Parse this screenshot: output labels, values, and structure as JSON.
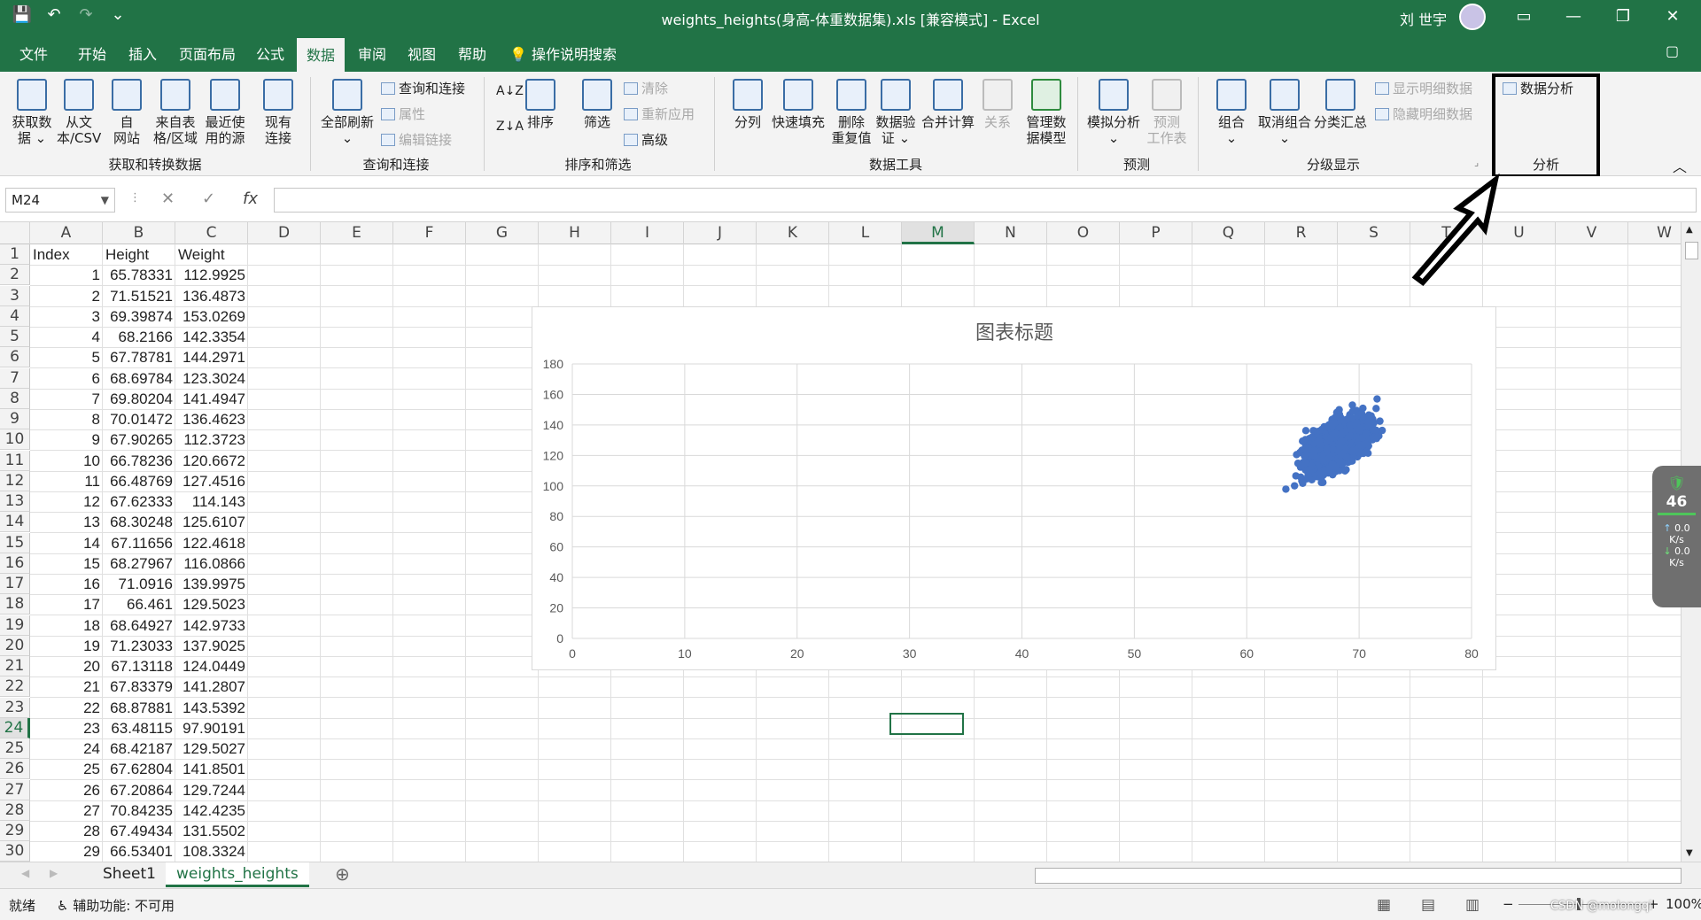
{
  "window": {
    "title": "weights_heights(身高-体重数据集).xls  [兼容模式]  -  Excel",
    "user": "刘 世宇",
    "minimize": "—",
    "maximize": "❐",
    "close": "✕"
  },
  "qat": {
    "save": "💾",
    "undo": "↶",
    "redo": "↷",
    "customize": "⌄"
  },
  "tabs": [
    "文件",
    "开始",
    "插入",
    "页面布局",
    "公式",
    "数据",
    "审阅",
    "视图",
    "帮助"
  ],
  "active_tab": "数据",
  "search_label": "操作说明搜索",
  "ribbon": {
    "get_data": "获取数\n据 ⌄",
    "from_csv": "从文\n本/CSV",
    "from_web": "自\n网站",
    "from_table": "来自表\n格/区域",
    "recent_sources": "最近使\n用的源",
    "existing_conn": "现有\n连接",
    "group1": "获取和转换数据",
    "refresh_all": "全部刷新\n⌄",
    "queries_conn": "查询和连接",
    "properties": "属性",
    "edit_links": "编辑链接",
    "group2": "查询和连接",
    "sort": "排序",
    "filter": "筛选",
    "clear": "清除",
    "reapply": "重新应用",
    "advanced": "高级",
    "group3": "排序和筛选",
    "text_to_col": "分列",
    "flash_fill": "快速填充",
    "remove_dup": "删除\n重复值",
    "data_val": "数据验\n证 ⌄",
    "consolidate": "合并计算",
    "relationships": "关系",
    "data_model": "管理数\n据模型",
    "group4": "数据工具",
    "what_if": "模拟分析\n⌄",
    "forecast_sheet": "预测\n工作表",
    "group5": "预测",
    "group_btn": "组合\n⌄",
    "ungroup": "取消组合\n⌄",
    "subtotal": "分类汇总",
    "show_detail": "显示明细数据",
    "hide_detail": "隐藏明细数据",
    "group6": "分级显示",
    "data_analysis": "数据分析",
    "group7": "分析"
  },
  "name_box": "M24",
  "columns": [
    "A",
    "B",
    "C",
    "D",
    "E",
    "F",
    "G",
    "H",
    "I",
    "J",
    "K",
    "L",
    "M",
    "N",
    "O",
    "P",
    "Q",
    "R",
    "S",
    "T",
    "U",
    "V",
    "W"
  ],
  "selected_column": "M",
  "selected_row": "24",
  "rows": [
    [
      "1",
      "Index",
      "Height",
      "Weight"
    ],
    [
      "2",
      "1",
      "65.78331",
      "112.9925"
    ],
    [
      "3",
      "2",
      "71.51521",
      "136.4873"
    ],
    [
      "4",
      "3",
      "69.39874",
      "153.0269"
    ],
    [
      "5",
      "4",
      "68.2166",
      "142.3354"
    ],
    [
      "6",
      "5",
      "67.78781",
      "144.2971"
    ],
    [
      "7",
      "6",
      "68.69784",
      "123.3024"
    ],
    [
      "8",
      "7",
      "69.80204",
      "141.4947"
    ],
    [
      "9",
      "8",
      "70.01472",
      "136.4623"
    ],
    [
      "10",
      "9",
      "67.90265",
      "112.3723"
    ],
    [
      "11",
      "10",
      "66.78236",
      "120.6672"
    ],
    [
      "12",
      "11",
      "66.48769",
      "127.4516"
    ],
    [
      "13",
      "12",
      "67.62333",
      "114.143"
    ],
    [
      "14",
      "13",
      "68.30248",
      "125.6107"
    ],
    [
      "15",
      "14",
      "67.11656",
      "122.4618"
    ],
    [
      "16",
      "15",
      "68.27967",
      "116.0866"
    ],
    [
      "17",
      "16",
      "71.0916",
      "139.9975"
    ],
    [
      "18",
      "17",
      "66.461",
      "129.5023"
    ],
    [
      "19",
      "18",
      "68.64927",
      "142.9733"
    ],
    [
      "20",
      "19",
      "71.23033",
      "137.9025"
    ],
    [
      "21",
      "20",
      "67.13118",
      "124.0449"
    ],
    [
      "22",
      "21",
      "67.83379",
      "141.2807"
    ],
    [
      "23",
      "22",
      "68.87881",
      "143.5392"
    ],
    [
      "24",
      "23",
      "63.48115",
      "97.90191"
    ],
    [
      "25",
      "24",
      "68.42187",
      "129.5027"
    ],
    [
      "26",
      "25",
      "67.62804",
      "141.8501"
    ],
    [
      "27",
      "26",
      "67.20864",
      "129.7244"
    ],
    [
      "28",
      "27",
      "70.84235",
      "142.4235"
    ],
    [
      "29",
      "28",
      "67.49434",
      "131.5502"
    ],
    [
      "30",
      "29",
      "66.53401",
      "108.3324"
    ]
  ],
  "chart_data": {
    "type": "scatter",
    "title": "图表标题",
    "xlabel": "",
    "ylabel": "",
    "xlim": [
      0,
      80
    ],
    "ylim": [
      0,
      180
    ],
    "xticks": [
      "0",
      "10",
      "20",
      "30",
      "40",
      "50",
      "60",
      "70",
      "80"
    ],
    "yticks": [
      "0",
      "20",
      "40",
      "60",
      "80",
      "100",
      "120",
      "140",
      "160",
      "180"
    ],
    "grid": true,
    "series": [
      {
        "color": "#4472c4",
        "x": [
          65.78331,
          71.51521,
          69.39874,
          68.2166,
          67.78781,
          68.69784,
          69.80204,
          70.01472,
          67.90265,
          66.78236,
          66.48769,
          67.62333,
          68.30248,
          67.11656,
          68.27967,
          71.0916,
          66.461,
          68.64927,
          71.23033,
          67.13118,
          67.83379,
          68.87881,
          63.48115,
          68.42187,
          67.62804,
          67.20864,
          70.84235,
          67.49434,
          66.53401
        ],
        "y": [
          112.9925,
          136.4873,
          153.0269,
          142.3354,
          144.2971,
          123.3024,
          141.4947,
          136.4623,
          112.3723,
          120.6672,
          127.4516,
          114.143,
          125.6107,
          122.4618,
          116.0866,
          139.9975,
          129.5023,
          142.9733,
          137.9025,
          124.0449,
          141.2807,
          143.5392,
          97.90191,
          129.5027,
          141.8501,
          129.7244,
          142.4235,
          131.5502,
          108.3324
        ]
      }
    ]
  },
  "sheets": [
    "Sheet1",
    "weights_heights"
  ],
  "active_sheet": "weights_heights",
  "status": {
    "ready": "就绪",
    "accessibility": "辅助功能: 不可用",
    "zoom": "100%"
  },
  "widget": {
    "percent": "46",
    "up": "0.0",
    "down": "0.0",
    "unit": "K/s"
  },
  "watermark": "CSDN @molongqi"
}
